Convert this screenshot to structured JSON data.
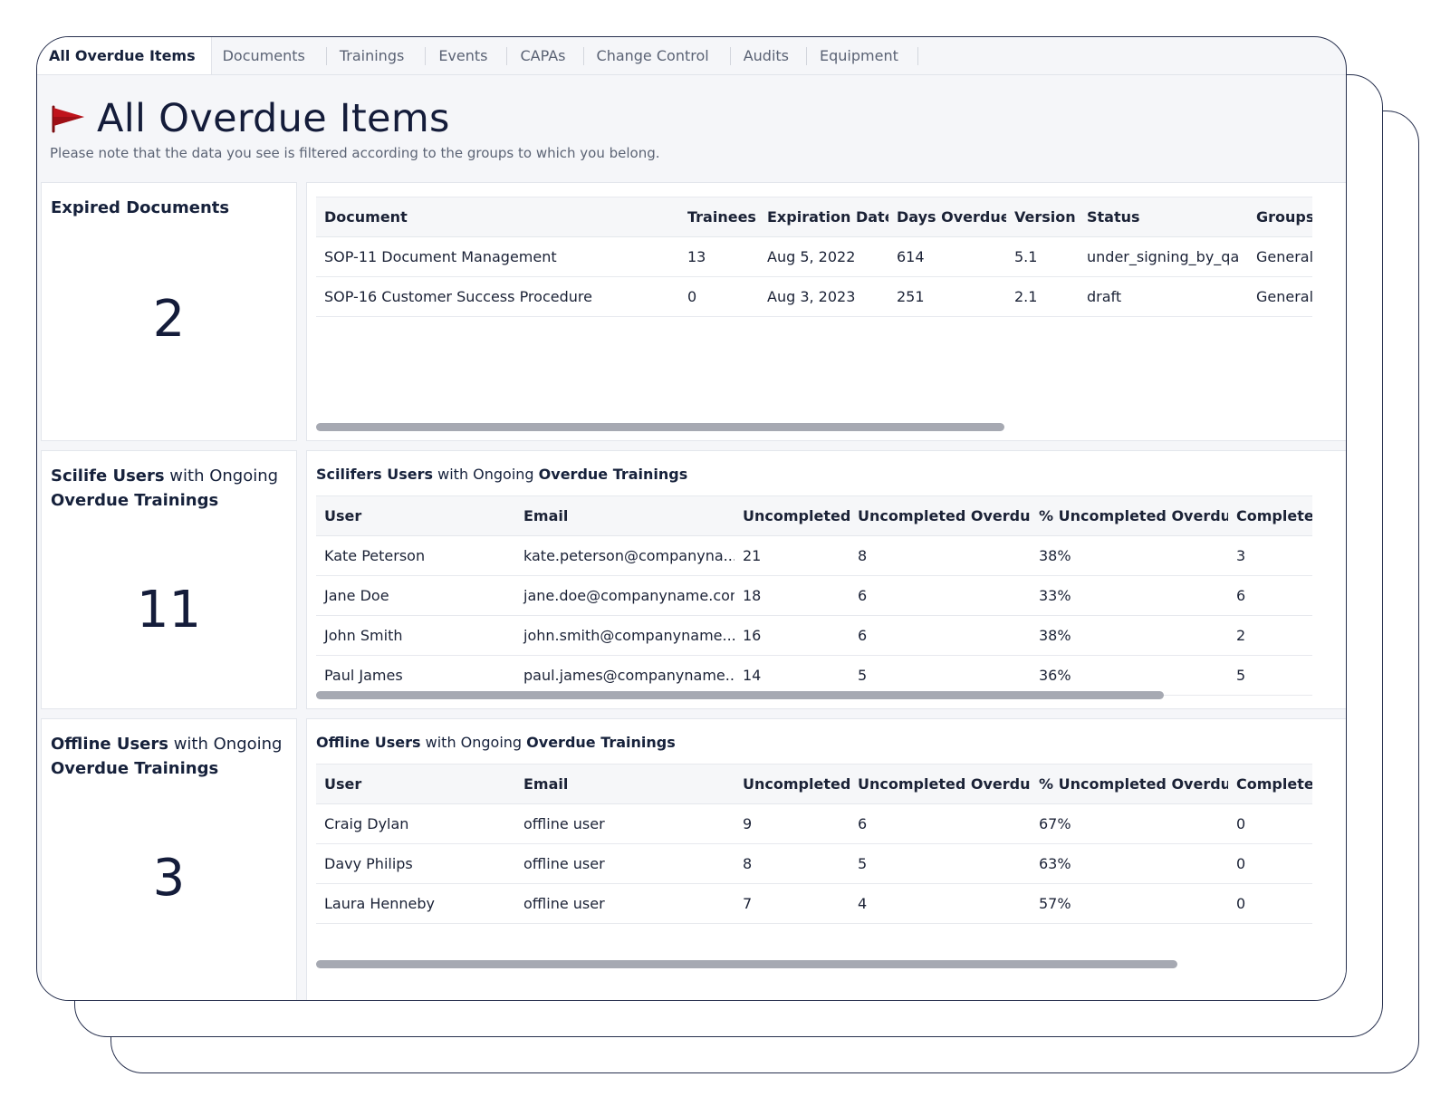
{
  "tabs": [
    {
      "label": "All Overdue Items",
      "active": true
    },
    {
      "label": "Documents"
    },
    {
      "label": "Trainings"
    },
    {
      "label": "Events"
    },
    {
      "label": "CAPAs"
    },
    {
      "label": "Change Control"
    },
    {
      "label": "Audits"
    },
    {
      "label": "Equipment"
    }
  ],
  "header": {
    "icon": "red-flag-icon",
    "title": "All Overdue Items",
    "note": "Please note that the data you see is filtered according to the groups to which you belong."
  },
  "expired_documents": {
    "kpi_title": "Expired Documents",
    "kpi_value": "2",
    "columns": [
      "Document",
      "Trainees",
      "Expiration Date",
      "Days Overdue",
      "Version",
      "Status",
      "Groups"
    ],
    "rows": [
      [
        "SOP-11 Document Management",
        "13",
        "Aug 5, 2022",
        "614",
        "5.1",
        "under_signing_by_qa",
        "General"
      ],
      [
        "SOP-16 Customer Success Procedure",
        "0",
        "Aug 3, 2023",
        "251",
        "2.1",
        "draft",
        "General"
      ]
    ]
  },
  "scilife_users": {
    "kpi_title_bold1": "Scilife Users",
    "kpi_title_mid": " with Ongoing ",
    "kpi_title_bold2": "Overdue Trainings",
    "kpi_value": "11",
    "table_title_bold1": "Scilifers Users",
    "table_title_mid": " with Ongoing ",
    "table_title_bold2": "Overdue Trainings",
    "columns": [
      "User",
      "Email",
      "Uncompleted",
      "Uncompleted Overdue",
      "% Uncompleted Overdue",
      "Completed"
    ],
    "rows": [
      [
        "Kate Peterson",
        "kate.peterson@companyna...",
        "21",
        "8",
        "38%",
        "3"
      ],
      [
        "Jane Doe",
        "jane.doe@companyname.com",
        "18",
        "6",
        "33%",
        "6"
      ],
      [
        "John Smith",
        "john.smith@companyname....",
        "16",
        "6",
        "38%",
        "2"
      ],
      [
        "Paul James",
        "paul.james@companyname....",
        "14",
        "5",
        "36%",
        "5"
      ]
    ]
  },
  "offline_users": {
    "kpi_title_bold1": "Offline Users",
    "kpi_title_mid": " with Ongoing ",
    "kpi_title_bold2": "Overdue Trainings",
    "kpi_value": "3",
    "table_title_bold1": "Offline Users",
    "table_title_mid": " with Ongoing ",
    "table_title_bold2": "Overdue Trainings",
    "columns": [
      "User",
      "Email",
      "Uncompleted",
      "Uncompleted Overdue",
      "% Uncompleted Overdue",
      "Completed"
    ],
    "rows": [
      [
        "Craig Dylan",
        "offline user",
        "9",
        "6",
        "67%",
        "0"
      ],
      [
        "Davy Philips",
        "offline user",
        "8",
        "5",
        "63%",
        "0"
      ],
      [
        "Laura Henneby",
        "offline user",
        "7",
        "4",
        "57%",
        "0"
      ]
    ]
  },
  "colors": {
    "accent_navy": "#141c3a",
    "flag_red": "#c0141c",
    "scrollbar": "#a6a9b2"
  }
}
